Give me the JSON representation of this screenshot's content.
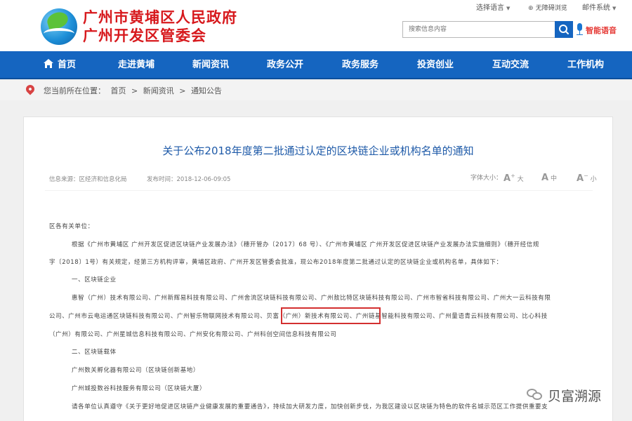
{
  "header": {
    "logo_line1": "广州市黄埔区人民政府",
    "logo_line2": "广州开发区管委会",
    "lang_select": "选择语言",
    "accessible": "无障碍浏览",
    "mail": "邮件系统",
    "search_placeholder": "搜索信息内容",
    "voice_search": "智能语音"
  },
  "nav": {
    "items": [
      "首页",
      "走进黄埔",
      "新闻资讯",
      "政务公开",
      "政务服务",
      "投资创业",
      "互动交流",
      "工作机构"
    ]
  },
  "breadcrumb": {
    "label": "您当前所在位置：",
    "items": [
      "首页",
      "新闻资讯",
      "通知公告"
    ],
    "separator": ">"
  },
  "article": {
    "title": "关于公布2018年度第二批通过认定的区块链企业或机构名单的通知",
    "source": "信息来源：区经济和信息化局",
    "date": "发布时间：2018-12-06-09:05",
    "font_label": "字体大小：",
    "font_large": "大",
    "font_medium": "中",
    "font_small": "小",
    "font_icon": "A",
    "font_plus": "+",
    "font_minus": "−",
    "lines": [
      "区各有关单位：",
      "根据《广州市黄埔区 广州开发区促进区块链产业发展办法》（穗开管办〔2017〕68 号）、《广州市黄埔区 广州开发区促进区块链产业发展办法实施细则》（穗开经信规",
      "字〔2018〕1号）有关规定，经第三方机构评审，黄埔区政府、广州开发区管委会批准，现公布2018年度第二批通过认定的区块链企业或机构名单，具体如下：",
      "一、区块链企业",
      "惠智（广州）技术有限公司、广州新辉易科技有限公司、广州舍流区块链科技有限公司、广州敖比特区块链科技有限公司、广州市智省科技有限公司、广州大一云科技有限",
      "公司、广州市云电运通区块链科技有限公司、广州智乐物联网技术有限公司、贝富（广州）新技术有限公司、广州链基智能科技有限公司、广州量语青云科技有限公司、比心科技",
      "（广州）有限公司、广州星城信息科技有限公司、广州安化有限公司、广州科创空间信息科技有限公司",
      "二、区块链载体",
      "广州数关孵化器有限公司（区块链创新基地）",
      "广州城投数谷科技服务有限公司（区块链大厦）",
      "请各单位认真遵守《关于更好地促进区块链产业健康发展的重要通告》，持续加大研发力度，加快创新步伐，为我区建设以区块链为特色的软件名城示范区工作提供重要支"
    ]
  },
  "watermark": {
    "text": "贝富溯源"
  }
}
